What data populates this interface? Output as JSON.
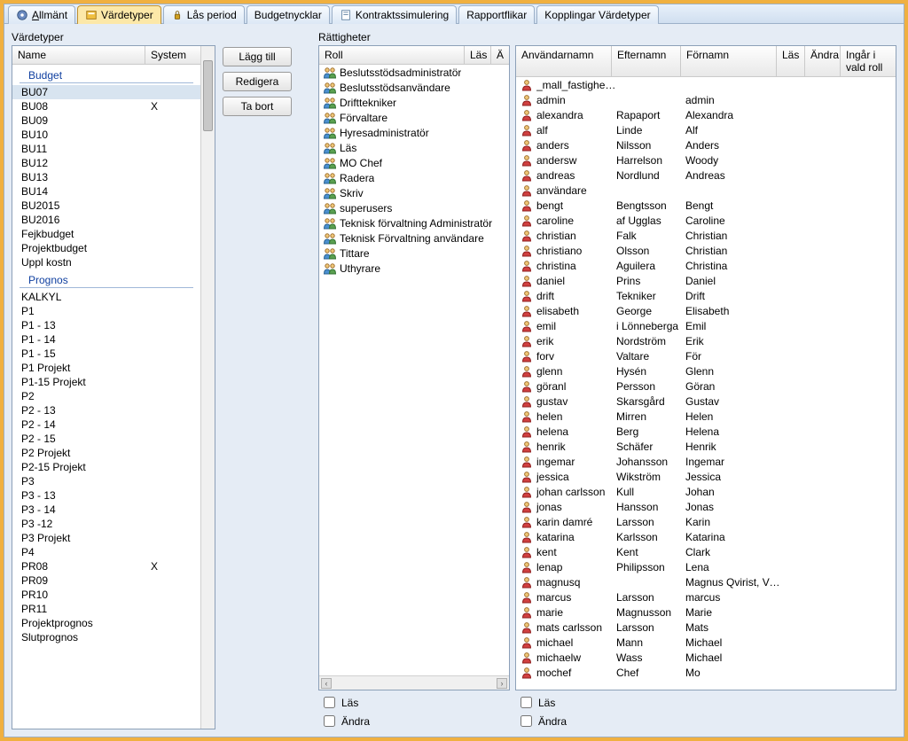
{
  "tabs": [
    {
      "label": "Allmänt",
      "underlined": true
    },
    {
      "label": "Värdetyper"
    },
    {
      "label": "Lås period"
    },
    {
      "label": "Budgetnycklar"
    },
    {
      "label": "Kontraktssimulering"
    },
    {
      "label": "Rapportflikar"
    },
    {
      "label": "Kopplingar Värdetyper"
    }
  ],
  "active_tab": 1,
  "left": {
    "title": "Värdetyper",
    "headers": [
      "Name",
      "System"
    ],
    "groups": [
      {
        "name": "Budget",
        "items": [
          {
            "name": "BU07",
            "system": "",
            "selected": true
          },
          {
            "name": "BU08",
            "system": "X"
          },
          {
            "name": "BU09",
            "system": ""
          },
          {
            "name": "BU10",
            "system": ""
          },
          {
            "name": "BU11",
            "system": ""
          },
          {
            "name": "BU12",
            "system": ""
          },
          {
            "name": "BU13",
            "system": ""
          },
          {
            "name": "BU14",
            "system": ""
          },
          {
            "name": "BU2015",
            "system": ""
          },
          {
            "name": "BU2016",
            "system": ""
          },
          {
            "name": "Fejkbudget",
            "system": ""
          },
          {
            "name": "Projektbudget",
            "system": ""
          },
          {
            "name": "Uppl kostn",
            "system": ""
          }
        ]
      },
      {
        "name": "Prognos",
        "items": [
          {
            "name": "KALKYL",
            "system": ""
          },
          {
            "name": "P1",
            "system": ""
          },
          {
            "name": "P1 - 13",
            "system": ""
          },
          {
            "name": "P1 - 14",
            "system": ""
          },
          {
            "name": "P1 - 15",
            "system": ""
          },
          {
            "name": "P1 Projekt",
            "system": ""
          },
          {
            "name": "P1-15 Projekt",
            "system": ""
          },
          {
            "name": "P2",
            "system": ""
          },
          {
            "name": "P2 - 13",
            "system": ""
          },
          {
            "name": "P2 - 14",
            "system": ""
          },
          {
            "name": "P2 - 15",
            "system": ""
          },
          {
            "name": "P2 Projekt",
            "system": ""
          },
          {
            "name": "P2-15 Projekt",
            "system": ""
          },
          {
            "name": "P3",
            "system": ""
          },
          {
            "name": "P3 - 13",
            "system": ""
          },
          {
            "name": "P3 - 14",
            "system": ""
          },
          {
            "name": "P3 -12",
            "system": ""
          },
          {
            "name": "P3 Projekt",
            "system": ""
          },
          {
            "name": "P4",
            "system": ""
          },
          {
            "name": "PR08",
            "system": "X"
          },
          {
            "name": "PR09",
            "system": ""
          },
          {
            "name": "PR10",
            "system": ""
          },
          {
            "name": "PR11",
            "system": ""
          },
          {
            "name": "Projektprognos",
            "system": ""
          },
          {
            "name": "Slutprognos",
            "system": ""
          }
        ]
      }
    ]
  },
  "buttons": {
    "add": "Lägg till",
    "edit": "Redigera",
    "delete": "Ta bort"
  },
  "rights": {
    "title": "Rättigheter",
    "roles_headers": [
      "Roll",
      "Läs",
      "Ä"
    ],
    "roles": [
      "Beslutsstödsadministratör",
      "Beslutsstödsanvändare",
      "Drifttekniker",
      "Förvaltare",
      "Hyresadministratör",
      "Läs",
      "MO Chef",
      "Radera",
      "Skriv",
      "superusers",
      "Teknisk förvaltning Administratör",
      "Teknisk Förvaltning användare",
      "Tittare",
      "Uthyrare"
    ],
    "users_headers": [
      "Användarnamn",
      "Efternamn",
      "Förnamn",
      "Läs",
      "Ändra",
      "Ingår i vald roll"
    ],
    "users": [
      {
        "u": "_mall_fastighetweb",
        "e": "",
        "f": ""
      },
      {
        "u": "admin",
        "e": "",
        "f": "admin"
      },
      {
        "u": "alexandra",
        "e": "Rapaport",
        "f": "Alexandra"
      },
      {
        "u": "alf",
        "e": "Linde",
        "f": "Alf"
      },
      {
        "u": "anders",
        "e": "Nilsson",
        "f": "Anders"
      },
      {
        "u": "andersw",
        "e": "Harrelson",
        "f": "Woody"
      },
      {
        "u": "andreas",
        "e": "Nordlund",
        "f": "Andreas"
      },
      {
        "u": "användare",
        "e": "",
        "f": ""
      },
      {
        "u": "bengt",
        "e": "Bengtsson",
        "f": "Bengt"
      },
      {
        "u": "caroline",
        "e": "af Ugglas",
        "f": "Caroline"
      },
      {
        "u": "christian",
        "e": "Falk",
        "f": "Christian"
      },
      {
        "u": "christiano",
        "e": "Olsson",
        "f": "Christian"
      },
      {
        "u": "christina",
        "e": "Aguilera",
        "f": "Christina"
      },
      {
        "u": "daniel",
        "e": "Prins",
        "f": "Daniel"
      },
      {
        "u": "drift",
        "e": "Tekniker",
        "f": "Drift"
      },
      {
        "u": "elisabeth",
        "e": "George",
        "f": "Elisabeth"
      },
      {
        "u": "emil",
        "e": "i Lönneberga",
        "f": "Emil"
      },
      {
        "u": "erik",
        "e": "Nordström",
        "f": "Erik"
      },
      {
        "u": "forv",
        "e": "Valtare",
        "f": "För"
      },
      {
        "u": "glenn",
        "e": "Hysén",
        "f": "Glenn"
      },
      {
        "u": "göranl",
        "e": "Persson",
        "f": "Göran"
      },
      {
        "u": "gustav",
        "e": "Skarsgård",
        "f": "Gustav"
      },
      {
        "u": "helen",
        "e": "Mirren",
        "f": "Helen"
      },
      {
        "u": "helena",
        "e": "Berg",
        "f": "Helena"
      },
      {
        "u": "henrik",
        "e": "Schäfer",
        "f": "Henrik"
      },
      {
        "u": "ingemar",
        "e": "Johansson",
        "f": "Ingemar"
      },
      {
        "u": "jessica",
        "e": "Wikström",
        "f": "Jessica"
      },
      {
        "u": "johan carlsson",
        "e": "Kull",
        "f": "Johan"
      },
      {
        "u": "jonas",
        "e": "Hansson",
        "f": "Jonas"
      },
      {
        "u": "karin damré",
        "e": "Larsson",
        "f": "Karin"
      },
      {
        "u": "katarina",
        "e": "Karlsson",
        "f": "Katarina"
      },
      {
        "u": "kent",
        "e": "Kent",
        "f": "Clark"
      },
      {
        "u": "lenap",
        "e": "Philipsson",
        "f": "Lena"
      },
      {
        "u": "magnusq",
        "e": "",
        "f": "Magnus Qvirist, Vitec"
      },
      {
        "u": "marcus",
        "e": "Larsson",
        "f": "marcus"
      },
      {
        "u": "marie",
        "e": "Magnusson",
        "f": "Marie"
      },
      {
        "u": "mats carlsson",
        "e": "Larsson",
        "f": "Mats"
      },
      {
        "u": "michael",
        "e": "Mann",
        "f": "Michael"
      },
      {
        "u": "michaelw",
        "e": "Wass",
        "f": "Michael"
      },
      {
        "u": "mochef",
        "e": "Chef",
        "f": "Mo"
      }
    ],
    "checks": {
      "read": "Läs",
      "edit": "Ändra"
    }
  }
}
